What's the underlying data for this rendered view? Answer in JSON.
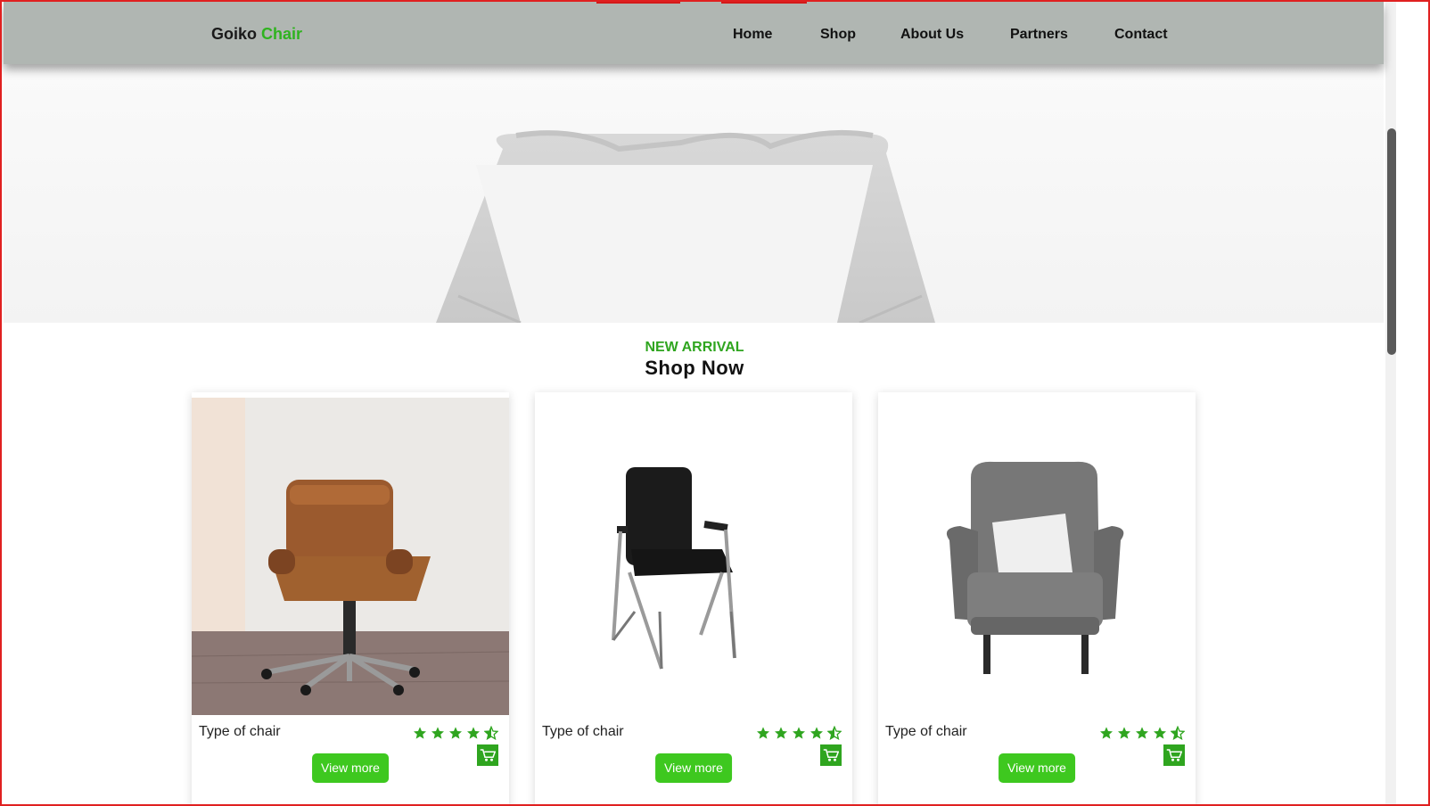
{
  "header": {
    "brand_first": "Goiko",
    "brand_accent": "Chair",
    "nav": [
      "Home",
      "Shop",
      "About Us",
      "Partners",
      "Contact"
    ]
  },
  "section": {
    "kicker": "NEW ARRIVAL",
    "title": "Shop Now"
  },
  "products": [
    {
      "name": "Type of chair",
      "rating": 4.5,
      "button": "View more",
      "image": "brown-leather-office-chair"
    },
    {
      "name": "Type of chair",
      "rating": 4.5,
      "button": "View more",
      "image": "black-metal-frame-chair"
    },
    {
      "name": "Type of chair",
      "rating": 4.5,
      "button": "View more",
      "image": "grey-wingback-armchair"
    }
  ],
  "colors": {
    "accent": "#2fb31f",
    "button": "#3ec81f",
    "header_bg": "#b0b6b2",
    "border": "#e02020"
  },
  "icons": [
    "star-icon",
    "half-star-icon",
    "cart-icon"
  ]
}
